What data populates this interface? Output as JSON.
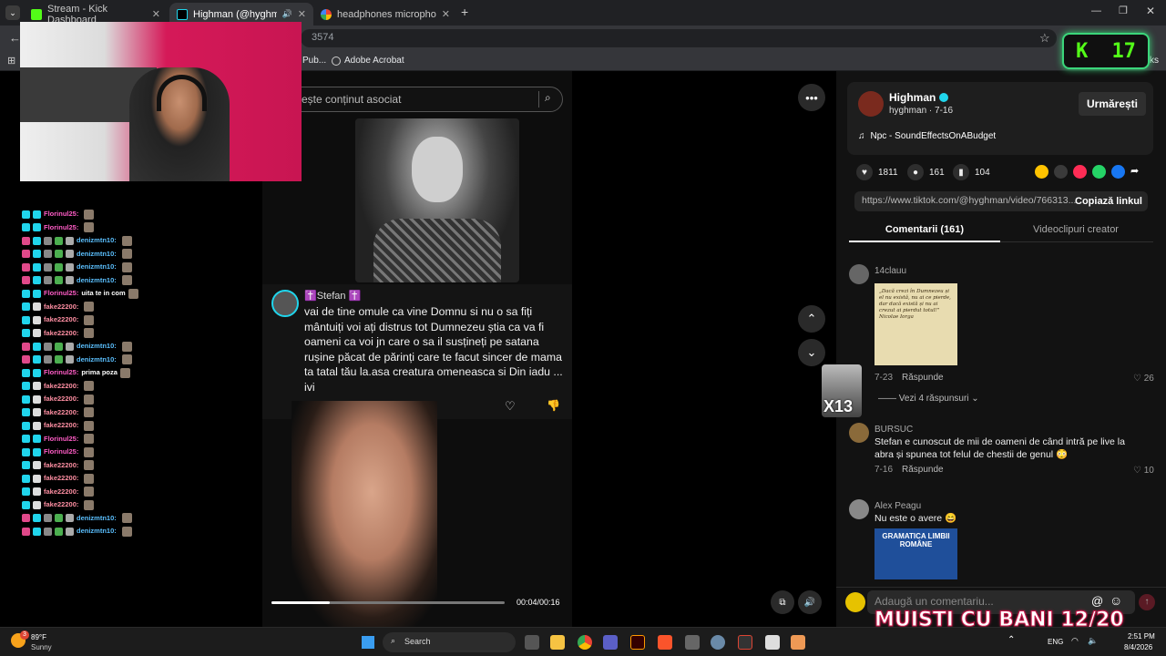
{
  "tabs": [
    {
      "label": "Stream - Kick Dashboard",
      "active": false
    },
    {
      "label": "Highman (@hyghman) | Tik",
      "active": true
    },
    {
      "label": "headphones microphone not w",
      "active": false
    }
  ],
  "address": {
    "url": "3574"
  },
  "bookmarks": [
    {
      "label": "Pub..."
    },
    {
      "label": "Adobe Acrobat"
    }
  ],
  "bookmarks_right": "ks",
  "video": {
    "search_placeholder": "ește conținut asociat",
    "comment_author": "✝️Stefan ✝️",
    "comment_text": "vai de tine omule ca vine Domnu si nu o sa fiți mântuiți voi ați distrus tot Dumnezeu știa ca va fi oameni ca voi jn care o sa il susțineți pe satana rușine păcat de părinți care te facut sincer de mama ta tatal tău la.asa creatura omeneasca si Din iadu ... ivi",
    "time": "00:04/00:16",
    "progress": 0.25
  },
  "creator": {
    "name": "Highman",
    "handle_date": "hyghman · 7-16",
    "follow_label": "Urmărești",
    "music": "Npc - SoundEffectsOnABudget",
    "likes": "1811",
    "comments": "161",
    "saves": "104",
    "link": "https://www.tiktok.com/@hyghman/video/766313...",
    "copy_label": "Copiază linkul"
  },
  "comment_tabs": {
    "comments": "Comentarii (161)",
    "creator_videos": "Videoclipuri creator"
  },
  "comments": [
    {
      "user": "14clauu",
      "image_caption": "„Dacă crezi în Dumnezeu și el nu există, nu ai ce pierde, dar dacă există și nu ai crezut ai pierdut totul!” Nicolae Iorga",
      "date": "7-23",
      "reply": "Răspunde",
      "likes": "26",
      "view_replies": "Vezi 4 răspunsuri"
    },
    {
      "user": "BURSUC",
      "text": "Stefan e cunoscut de mii de oameni de când intră pe live la abra și spunea tot felul de chestii de genul 😳",
      "date": "7-16",
      "reply": "Răspunde",
      "likes": "10"
    },
    {
      "user": "Alex Peagu",
      "text": "Nu este o avere 😄",
      "image_title": "GRAMATICA LIMBII ROMÂNE"
    }
  ],
  "add_comment_placeholder": "Adaugă un comentariu...",
  "gift_overlay": "X13",
  "chat": [
    {
      "user": "Florinul25:",
      "msg": "",
      "color": "#ff5cc6"
    },
    {
      "user": "Florinul25:",
      "msg": "",
      "color": "#ff5cc6"
    },
    {
      "user": "denizmtn10:",
      "msg": "",
      "color": "#5bc0ff"
    },
    {
      "user": "denizmtn10:",
      "msg": "",
      "color": "#5bc0ff"
    },
    {
      "user": "denizmtn10:",
      "msg": "",
      "color": "#5bc0ff"
    },
    {
      "user": "denizmtn10:",
      "msg": "",
      "color": "#5bc0ff"
    },
    {
      "user": "Florinul25:",
      "msg": "uita te in com",
      "color": "#ff5cc6"
    },
    {
      "user": "fake22200:",
      "msg": "",
      "color": "#ff8fa3"
    },
    {
      "user": "fake22200:",
      "msg": "",
      "color": "#ff8fa3"
    },
    {
      "user": "fake22200:",
      "msg": "",
      "color": "#ff8fa3"
    },
    {
      "user": "denizmtn10:",
      "msg": "",
      "color": "#5bc0ff"
    },
    {
      "user": "denizmtn10:",
      "msg": "",
      "color": "#5bc0ff"
    },
    {
      "user": "Florinul25:",
      "msg": "prima poza",
      "color": "#ff5cc6"
    },
    {
      "user": "fake22200:",
      "msg": "",
      "color": "#ff8fa3"
    },
    {
      "user": "fake22200:",
      "msg": "",
      "color": "#ff8fa3"
    },
    {
      "user": "fake22200:",
      "msg": "",
      "color": "#ff8fa3"
    },
    {
      "user": "fake22200:",
      "msg": "",
      "color": "#ff8fa3"
    },
    {
      "user": "Florinul25:",
      "msg": "",
      "color": "#ff5cc6"
    },
    {
      "user": "Florinul25:",
      "msg": "",
      "color": "#ff5cc6"
    },
    {
      "user": "fake22200:",
      "msg": "",
      "color": "#ff8fa3"
    },
    {
      "user": "fake22200:",
      "msg": "",
      "color": "#ff8fa3"
    },
    {
      "user": "fake22200:",
      "msg": "",
      "color": "#ff8fa3"
    },
    {
      "user": "fake22200:",
      "msg": "",
      "color": "#ff8fa3"
    },
    {
      "user": "denizmtn10:",
      "msg": "",
      "color": "#5bc0ff"
    },
    {
      "user": "denizmtn10:",
      "msg": "",
      "color": "#5bc0ff"
    }
  ],
  "kick": {
    "logo": "K",
    "count": "17"
  },
  "banner": "MUISTI CU BANI 12/20",
  "taskbar": {
    "weather_temp": "89°F",
    "weather_desc": "Sunny",
    "search": "Search",
    "lang": "ENG",
    "time": "2:51 PM",
    "date": "8/4/2026",
    "badge": "3"
  },
  "colors": {
    "accent": "#fe2c55",
    "kick_green": "#53fc18",
    "tiktok_cyan": "#20d5ec"
  }
}
